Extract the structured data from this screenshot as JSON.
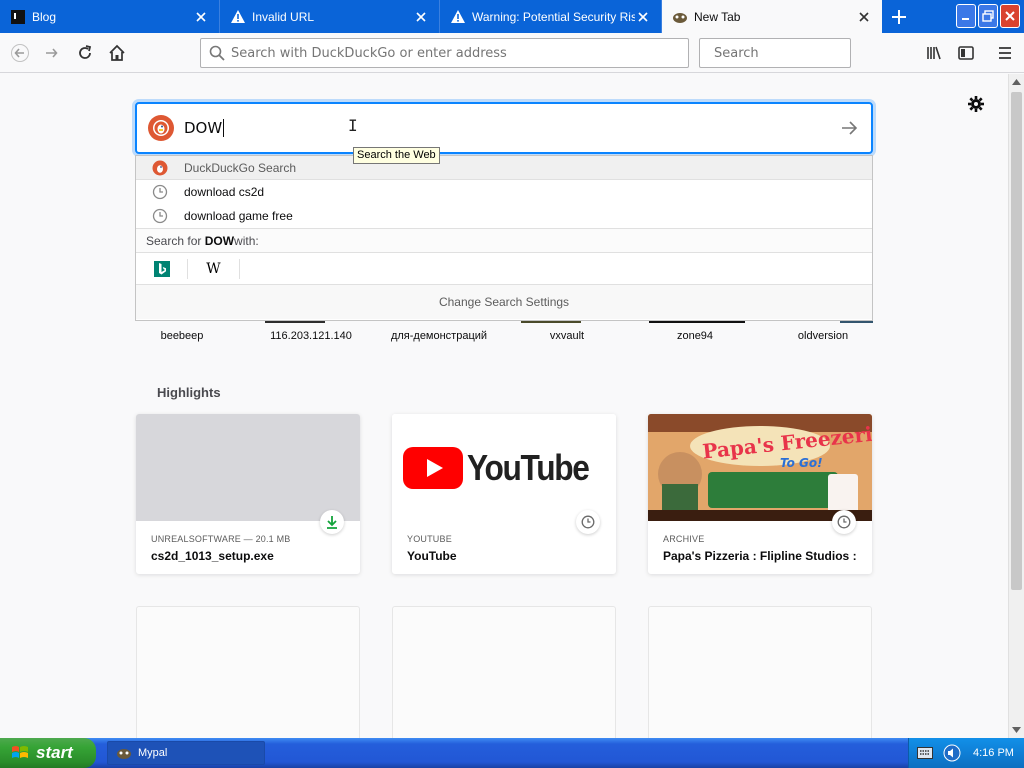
{
  "tabs": [
    {
      "title": "Blog",
      "icon": "terminal-icon",
      "active": false
    },
    {
      "title": "Invalid URL",
      "icon": "warning-icon",
      "active": false
    },
    {
      "title": "Warning: Potential Security Risk Ahead",
      "icon": "warning-icon",
      "active": false
    },
    {
      "title": "New Tab",
      "icon": "mypal-icon",
      "active": true
    }
  ],
  "navbar": {
    "url_placeholder": "Search with DuckDuckGo or enter address",
    "search_placeholder": "Search"
  },
  "search": {
    "query": "DOW",
    "tooltip": "Search the Web",
    "engine_header": "DuckDuckGo Search",
    "suggestions": [
      "download cs2d",
      "download game free"
    ],
    "search_for_prefix": "Search for ",
    "search_for_term": "DOW",
    "search_for_suffix": " with:",
    "change_settings": "Change Search Settings"
  },
  "topsites": [
    "beebeep",
    "116.203.121.140",
    "для-демонстраций",
    "vxvault",
    "zone94",
    "oldversion"
  ],
  "highlights": {
    "title": "Highlights",
    "cards": [
      {
        "source": "UNREALSOFTWARE — 20.1 MB",
        "title": "cs2d_1013_setup.exe",
        "badge": "download-icon"
      },
      {
        "source": "YOUTUBE",
        "title": "YouTube",
        "badge": "history-icon",
        "logo_text": "YouTube"
      },
      {
        "source": "ARCHIVE",
        "title": "Papa's Pizzeria : Flipline Studios :...",
        "badge": "history-icon",
        "art_title": "Papa's Freezeria",
        "art_sub": "To Go!"
      }
    ]
  },
  "taskbar": {
    "start_label": "start",
    "task_label": "Mypal",
    "clock": "4:16 PM"
  },
  "colors": {
    "tab_strip": "#0a64d8",
    "focus_ring": "#0a84ff",
    "ddg": "#de5833",
    "youtube_red": "#ff0000"
  }
}
